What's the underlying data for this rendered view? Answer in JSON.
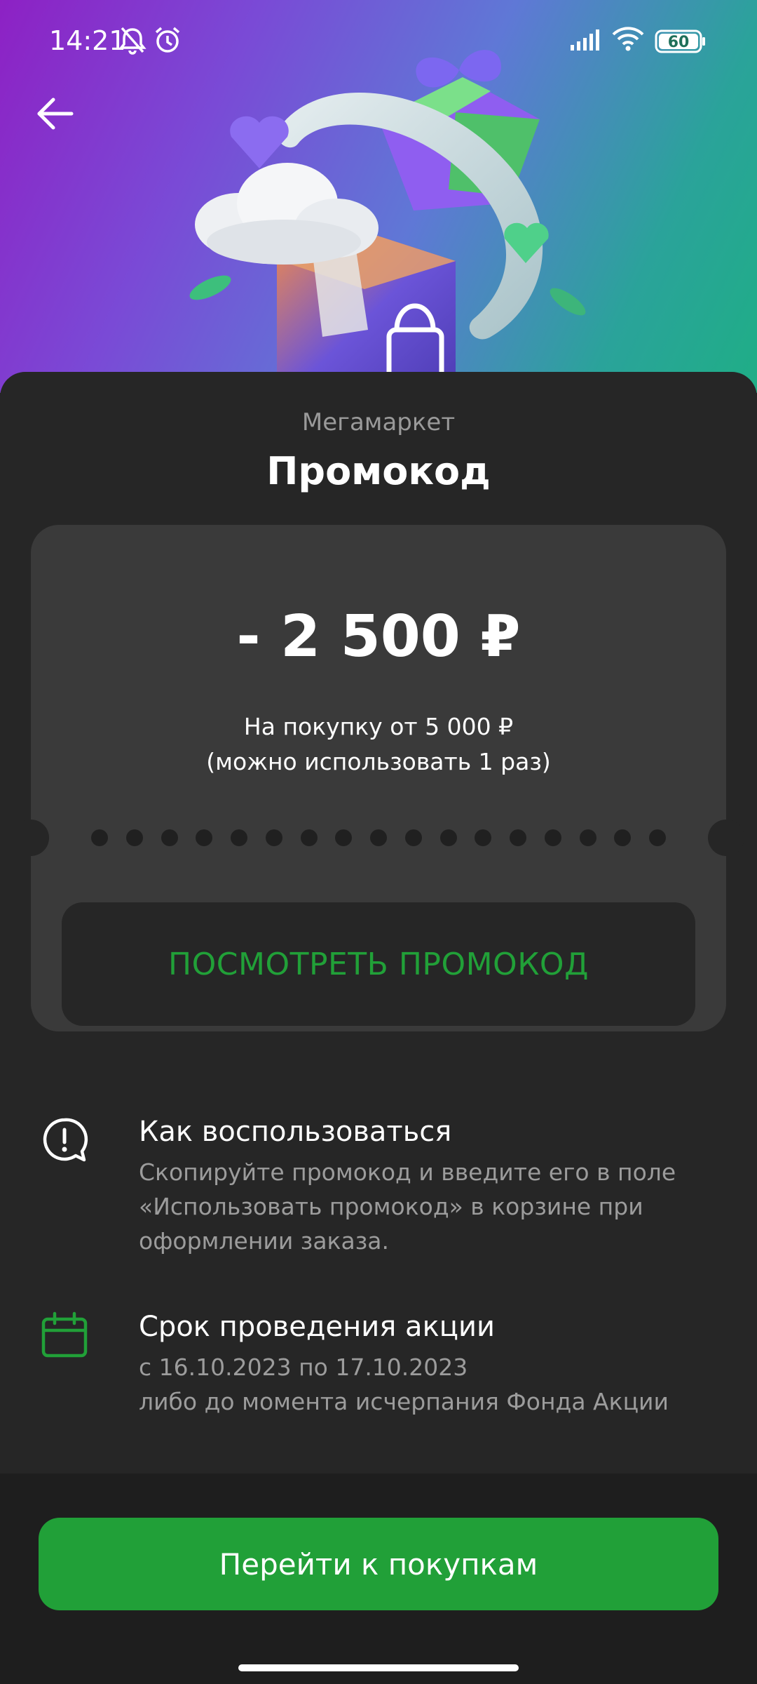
{
  "status_bar": {
    "time": "14:21",
    "battery": "60",
    "icons": [
      "bell-muted-icon",
      "alarm-icon",
      "signal-icon",
      "wifi-icon",
      "battery-icon"
    ]
  },
  "header": {
    "back_icon": "arrow-left-icon"
  },
  "sheet": {
    "brand": "Мегамаркет",
    "title": "Промокод"
  },
  "coupon": {
    "amount": "- 2 500 ₽",
    "condition_line1": "На покупку от 5 000 ₽",
    "condition_line2": "(можно использовать 1 раз)",
    "show_button_label": "ПОСМОТРЕТЬ ПРОМОКОД"
  },
  "info": [
    {
      "icon": "alert-bubble-icon",
      "title": "Как воспользоваться",
      "lines": [
        "Скопируйте промокод и введите его в поле",
        "«Использовать промокод» в корзине при",
        "оформлении заказа."
      ]
    },
    {
      "icon": "calendar-icon",
      "title": "Срок проведения акции",
      "lines": [
        "с 16.10.2023 по 17.10.2023",
        "либо до момента исчерпания Фонда Акции"
      ]
    }
  ],
  "cta": {
    "label": "Перейти к покупкам"
  },
  "colors": {
    "accent_green": "#21a038",
    "background": "#262626",
    "card": "#3a3a3a",
    "muted_text": "#9c9c9c"
  }
}
